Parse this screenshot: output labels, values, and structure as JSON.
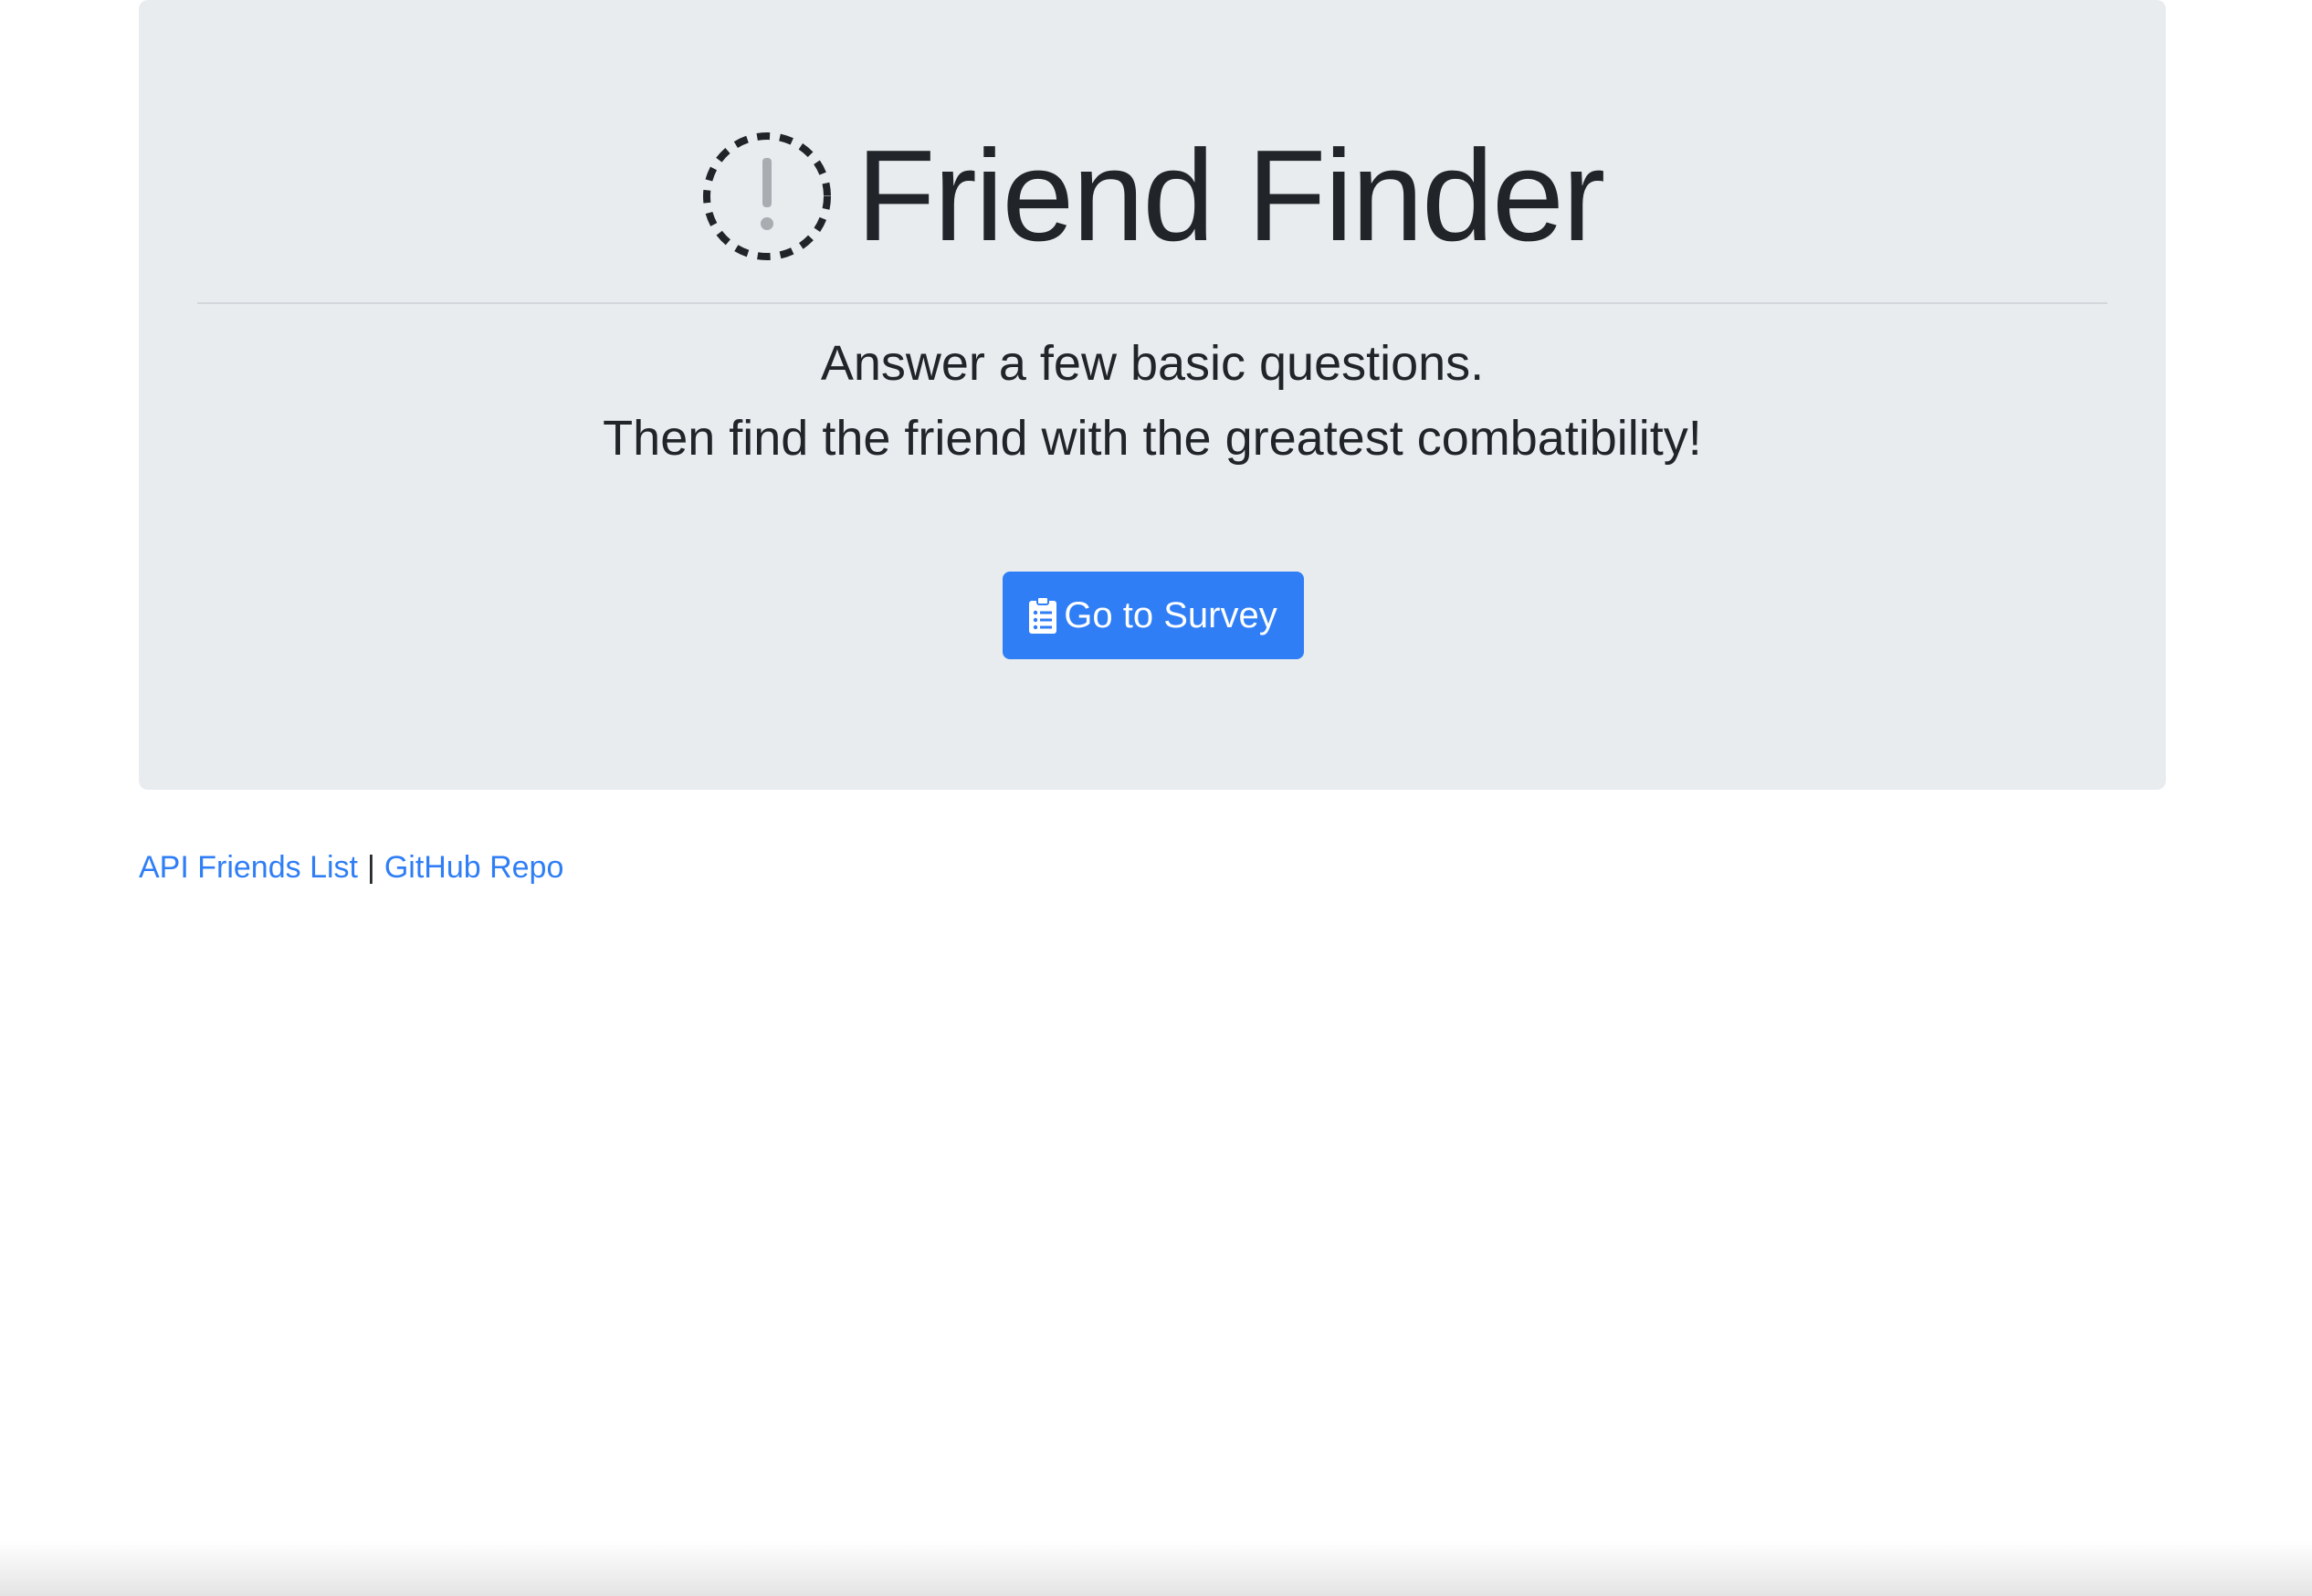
{
  "header": {
    "logo_icon": "exclamation-circle-dashed-icon",
    "title": "Friend Finder"
  },
  "lead": {
    "line1": "Answer a few basic questions.",
    "line2": "Then find the friend with the greatest combatibility!"
  },
  "survey_button": {
    "icon": "clipboard-list-icon",
    "label": "Go to Survey"
  },
  "footer": {
    "api_link": "API Friends List",
    "separator": "|",
    "github_link": "GitHub Repo"
  },
  "colors": {
    "jumbotron_bg": "#e9ecef",
    "primary": "#2f7ef6",
    "text": "#212529"
  }
}
